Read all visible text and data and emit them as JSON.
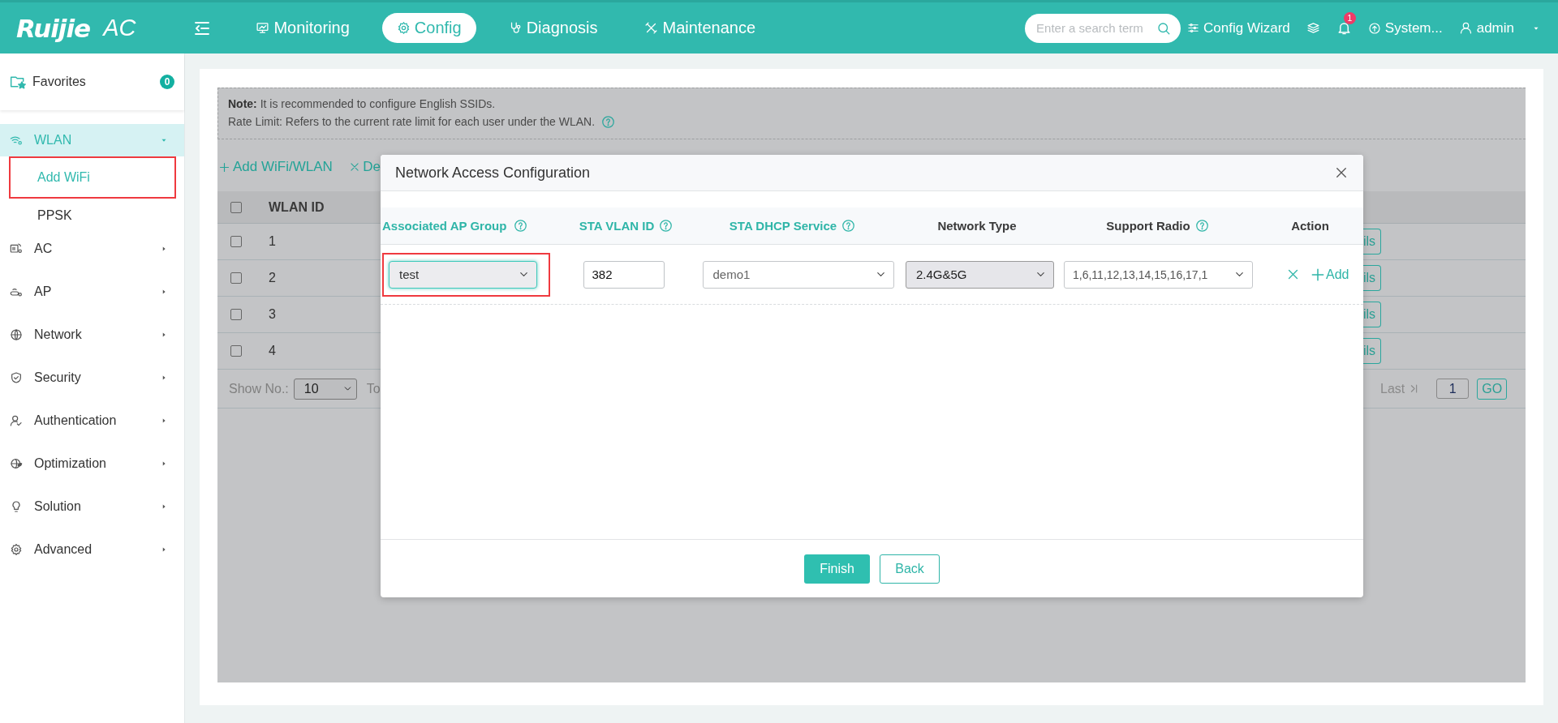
{
  "header": {
    "logo": "Ruijie",
    "product": "AC",
    "nav": [
      {
        "label": "Monitoring",
        "selected": false
      },
      {
        "label": "Config",
        "selected": true
      },
      {
        "label": "Diagnosis",
        "selected": false
      },
      {
        "label": "Maintenance",
        "selected": false
      }
    ],
    "search": {
      "placeholder": "Enter a search term"
    },
    "config_wizard": "Config Wizard",
    "notifications": "1",
    "system": "System...",
    "user": "admin"
  },
  "sidebar": {
    "favorites": {
      "label": "Favorites",
      "count": "0"
    },
    "items": [
      {
        "label": "WLAN",
        "selected": true,
        "expanded": true,
        "children": [
          {
            "label": "Add WiFi",
            "selected": true,
            "annotated": true
          },
          {
            "label": "PPSK",
            "selected": false,
            "annotated": false
          }
        ]
      },
      {
        "label": "AC",
        "selected": false,
        "expanded": false
      },
      {
        "label": "AP",
        "selected": false,
        "expanded": false
      },
      {
        "label": "Network",
        "selected": false,
        "expanded": false
      },
      {
        "label": "Security",
        "selected": false,
        "expanded": false
      },
      {
        "label": "Authentication",
        "selected": false,
        "expanded": false
      },
      {
        "label": "Optimization",
        "selected": false,
        "expanded": false
      },
      {
        "label": "Solution",
        "selected": false,
        "expanded": false
      },
      {
        "label": "Advanced",
        "selected": false,
        "expanded": false
      }
    ]
  },
  "page": {
    "note": "**Note:**  It is recommended to configure English SSIDs.",
    "rate_limit": "Rate Limit: Refers to the current rate limit for each user under the WLAN.",
    "toolbar": [
      {
        "kind": "add",
        "label": "Add WiFi/WLAN"
      },
      {
        "kind": "delete",
        "label": "De"
      }
    ],
    "table": {
      "columns": [
        "WLAN ID"
      ],
      "header_checked": false,
      "rows": [
        {
          "id": "1",
          "checked": false,
          "action": "ils"
        },
        {
          "id": "2",
          "checked": false,
          "action": "ils"
        },
        {
          "id": "3",
          "checked": false,
          "action": "ils"
        },
        {
          "id": "4",
          "checked": false,
          "action": "ils"
        }
      ]
    },
    "pagination": {
      "show_label": "Show No.:",
      "page_size": "10",
      "to_label": "To",
      "last": "Last",
      "page": "1",
      "go": "GO"
    }
  },
  "modal": {
    "title": "Network Access Configuration",
    "columns": [
      {
        "label": "Associated AP Group",
        "accent": true,
        "help": true
      },
      {
        "label": "STA VLAN ID",
        "accent": true,
        "help": true
      },
      {
        "label": "STA DHCP Service",
        "accent": true,
        "help": true
      },
      {
        "label": "Network Type",
        "accent": false,
        "help": false
      },
      {
        "label": "Support Radio",
        "accent": false,
        "help": true
      },
      {
        "label": "Action",
        "accent": false,
        "help": false
      }
    ],
    "rows": [
      {
        "ap_group": {
          "value": "test",
          "focused": true,
          "annotated": true
        },
        "vlan_id": "382",
        "dhcp_service": "demo1",
        "network_type": "2.4G&5G",
        "support_radio": "1,6,11,12,13,14,15,16,17,1",
        "add": "Add"
      }
    ],
    "buttons": [
      {
        "kind": "primary",
        "label": "Finish"
      },
      {
        "kind": "secondary",
        "label": "Back"
      }
    ]
  }
}
